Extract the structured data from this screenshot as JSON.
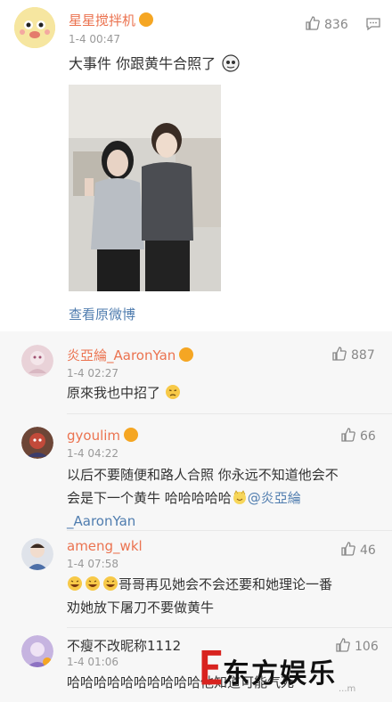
{
  "post": {
    "username": "星星搅拌机",
    "time": "1-4 00:47",
    "likes": "836",
    "text": "大事件 你跟黄牛合照了",
    "view_original": "查看原微博"
  },
  "comments": [
    {
      "username": "炎亞綸_AaronYan",
      "time": "1-4 02:27",
      "likes": "887",
      "text": "原來我也中招了"
    },
    {
      "username": "gyoulim",
      "time": "1-4 04:22",
      "likes": "66",
      "text_line1": "以后不要随便和路人合照 你永远不知道他会不",
      "text_line2": "会是下一个黄牛 哈哈哈哈哈",
      "mention": "@炎亞綸",
      "mention_line2": "_AaronYan"
    },
    {
      "username": "ameng_wkl",
      "time": "1-4 07:58",
      "likes": "46",
      "text_line1": "哥哥再见她会不会还要和她理论一番",
      "text_line2": "劝她放下屠刀不要做黄牛"
    },
    {
      "username": "不瘦不改昵称1112",
      "time": "1-4 01:06",
      "likes": "106",
      "text": "哈哈哈哈哈哈哈哈哈哈他知道可能气死"
    }
  ],
  "watermark": {
    "brand": "东方娱乐",
    "small": "...m"
  },
  "colors": {
    "username": "#eb7350",
    "link": "#507daf",
    "vip": "#f5a623"
  }
}
